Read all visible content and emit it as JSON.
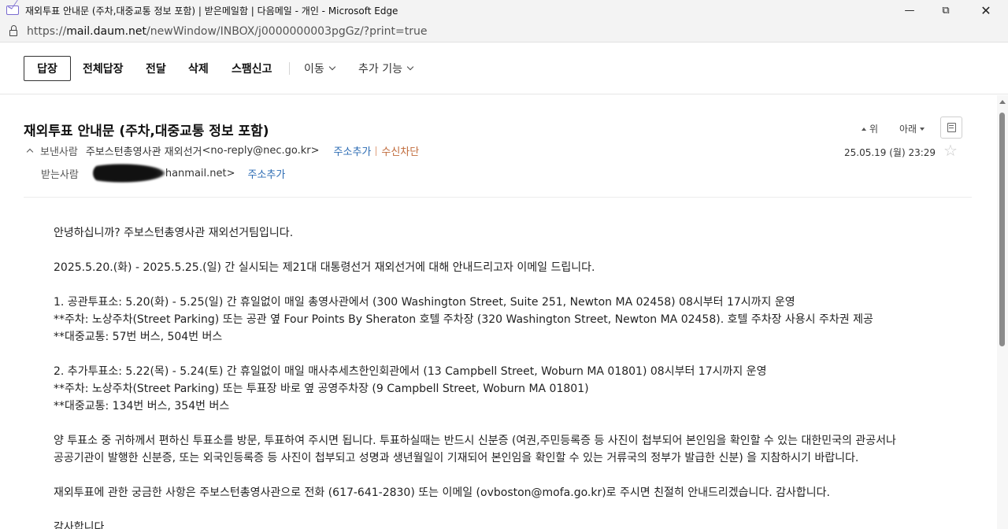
{
  "window": {
    "title": "재외투표 안내문 (주차,대중교통 정보 포함) | 받은메일함 | 다음메일 - 개인 - Microsoft Edge",
    "url_prefix": "https://",
    "url_host": "mail.daum.net",
    "url_path": "/newWindow/INBOX/j0000000003pgGz/?print=true",
    "minimize": "—",
    "maximize": "⧉",
    "close": "✕"
  },
  "toolbar": {
    "reply": "답장",
    "reply_all": "전체답장",
    "forward": "전달",
    "delete": "삭제",
    "report_spam": "스팸신고",
    "move": "이동",
    "more": "추가 기능"
  },
  "mail": {
    "subject": "재외투표 안내문 (주차,대중교통 정보 포함)",
    "prev_label": "위",
    "next_label": "아래",
    "sender_label": "보낸사람",
    "sender_name": "주보스턴총영사관 재외선거",
    "sender_email": "<no-reply@nec.go.kr>",
    "add_contact": "주소추가",
    "block": "수신차단",
    "recipient_label": "받는사람",
    "recipient_email": "hanmail.net>",
    "add_contact_2": "주소추가",
    "date": "25.05.19 (월) 23:29",
    "star": "☆"
  },
  "body": {
    "lines": [
      "안녕하십니까? 주보스턴총영사관 재외선거팀입니다.",
      "",
      "2025.5.20.(화) - 2025.5.25.(일) 간 실시되는 제21대 대통령선거 재외선거에 대해 안내드리고자 이메일 드립니다.",
      "",
      "1. 공관투표소: 5.20(화) - 5.25(일) 간 휴일없이 매일 총영사관에서 (300 Washington Street, Suite 251, Newton MA 02458) 08시부터 17시까지 운영",
      "**주차: 노상주차(Street Parking) 또는 공관 옆 Four Points By Sheraton 호텔 주차장 (320 Washington Street, Newton MA 02458). 호텔 주차장 사용시 주차권 제공",
      "**대중교통: 57번 버스, 504번 버스",
      "",
      "2. 추가투표소: 5.22(목) - 5.24(토) 간 휴일없이 매일 매사추세츠한인회관에서 (13 Campbell Street, Woburn MA 01801) 08시부터 17시까지 운영",
      "**주차: 노상주차(Street Parking) 또는 투표장 바로 옆 공영주차장 (9 Campbell Street, Woburn MA 01801)",
      "**대중교통: 134번 버스, 354번 버스",
      "",
      "양 투표소 중 귀하께서 편하신 투표소를 방문, 투표하여 주시면 됩니다. 투표하실때는 반드시 신분증 (여권,주민등록증 등 사진이 첩부되어 본인임을 확인할 수 있는 대한민국의 관공서나",
      "공공기관이 발행한 신분증, 또는 외국인등록증 등 사진이 첩부되고 성명과 생년월일이 기재되어 본인임을 확인할 수 있는 거류국의 정부가 발급한 신분) 을 지참하시기 바랍니다.",
      "",
      "재외투표에 관한 궁금한 사항은 주보스턴총영사관으로 전화 (617-641-2830) 또는 이메일 (ovboston@mofa.go.kr)로 주시면 친절히 안내드리겠습니다. 감사합니다.",
      "",
      "감사합니다"
    ]
  }
}
